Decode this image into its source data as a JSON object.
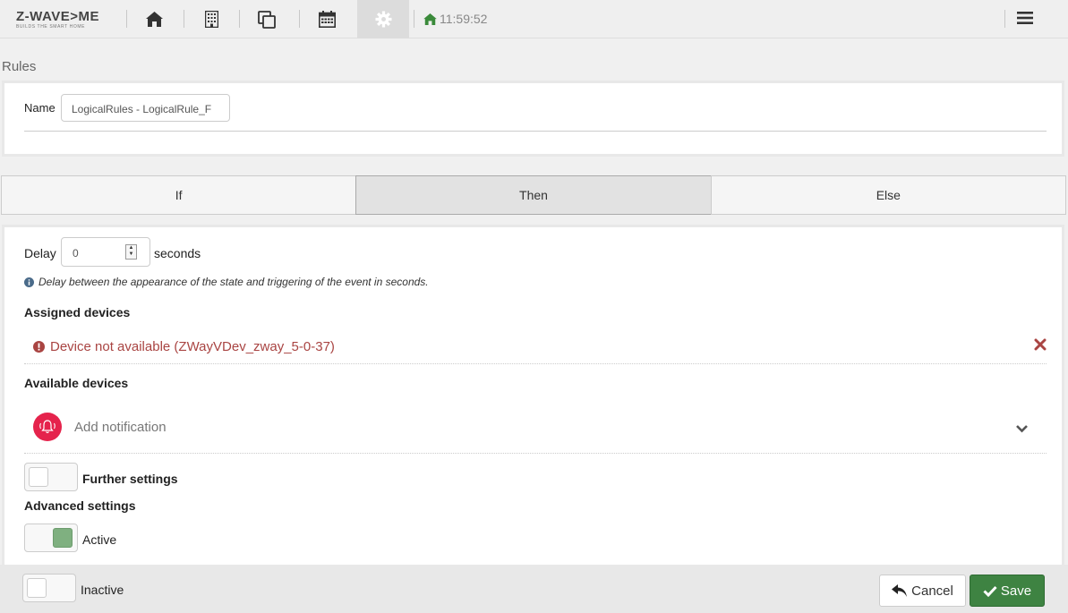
{
  "app": {
    "logo_text": "Z-WAVE>ME",
    "logo_tagline": "BUILDS THE SMART HOME",
    "clock": "11:59:52"
  },
  "nav": {
    "icons": [
      "home-icon",
      "building-icon",
      "copy-icon",
      "calendar-icon",
      "gear-icon",
      "menu-icon"
    ]
  },
  "page": {
    "title": "Rules",
    "name_label": "Name",
    "name_value": "LogicalRules - LogicalRule_F"
  },
  "tabs": [
    {
      "label": "If",
      "active": false
    },
    {
      "label": "Then",
      "active": true
    },
    {
      "label": "Else",
      "active": false
    }
  ],
  "then": {
    "delay_label": "Delay",
    "delay_value": "0",
    "delay_unit": "seconds",
    "delay_hint": "Delay between the appearance of the state and triggering of the event in seconds.",
    "assigned_heading": "Assigned devices",
    "assigned_error": "Device not available (ZWayVDev_zway_5-0-37)",
    "available_heading": "Available devices",
    "add_notification": "Add notification",
    "further_settings": "Further settings",
    "advanced_settings": "Advanced settings",
    "active_label": "Active",
    "inactive_label": "Inactive"
  },
  "footer": {
    "cancel": "Cancel",
    "save": "Save"
  },
  "colors": {
    "error": "#a94442",
    "save": "#3e8342",
    "toggle_on": "#7fb080",
    "notification": "#e5234c",
    "home_clock": "#3a8a3a"
  }
}
